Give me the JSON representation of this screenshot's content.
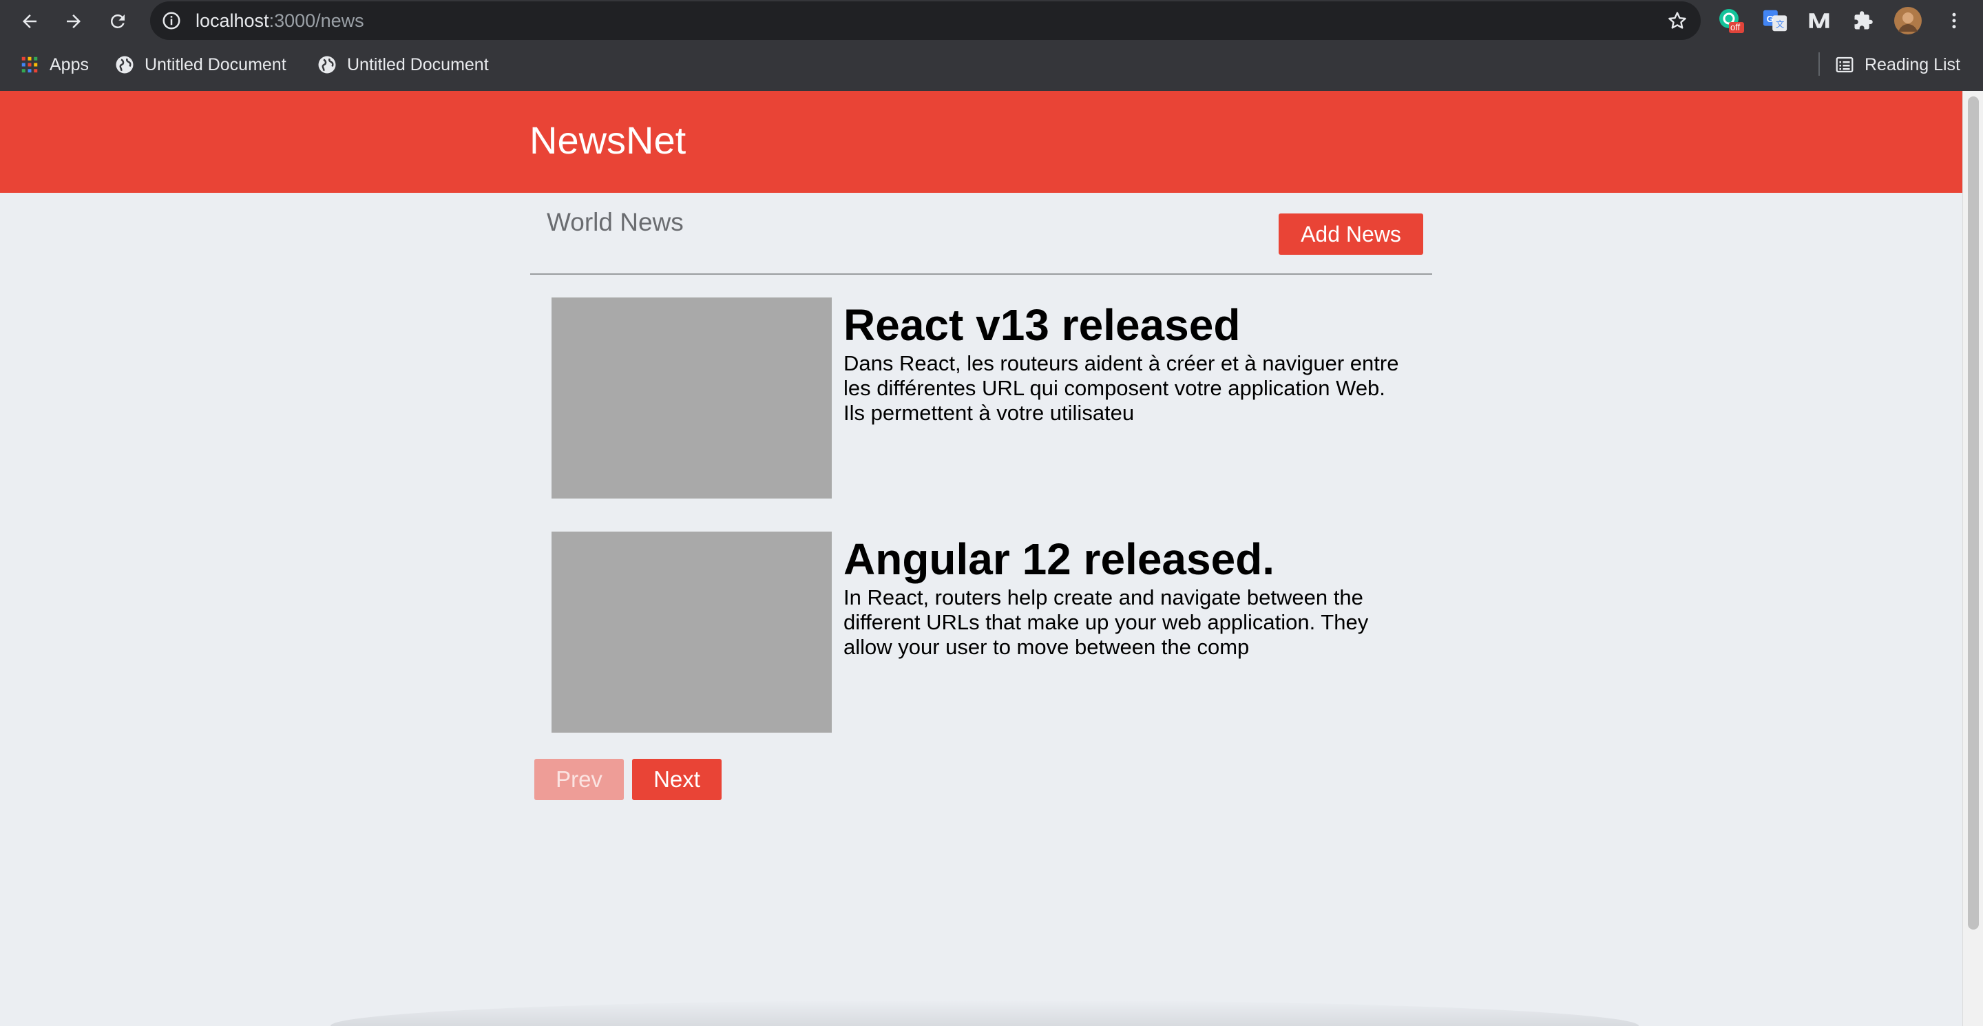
{
  "browser": {
    "url_host": "localhost",
    "url_path": ":3000/news",
    "extension_badge": "off",
    "bookmarks": [
      {
        "label": "Apps"
      },
      {
        "label": "Untitled Document"
      },
      {
        "label": "Untitled Document"
      }
    ],
    "reading_list_label": "Reading List"
  },
  "header": {
    "brand": "NewsNet"
  },
  "section": {
    "title": "World News",
    "add_button": "Add News"
  },
  "news": [
    {
      "title": "React v13 released",
      "body": "Dans React, les routeurs aident à créer et à naviguer entre les différentes URL qui composent votre application Web. Ils permettent à votre utilisateu"
    },
    {
      "title": "Angular 12 released.",
      "body": "In React, routers help create and navigate between the different URLs that make up your web application. They allow your user to move between the comp"
    }
  ],
  "pagination": {
    "prev_label": "Prev",
    "next_label": "Next",
    "prev_disabled": true
  },
  "colors": {
    "accent": "#e94436",
    "page_bg": "#ebeef2",
    "thumb_placeholder": "#a9a9a9"
  }
}
